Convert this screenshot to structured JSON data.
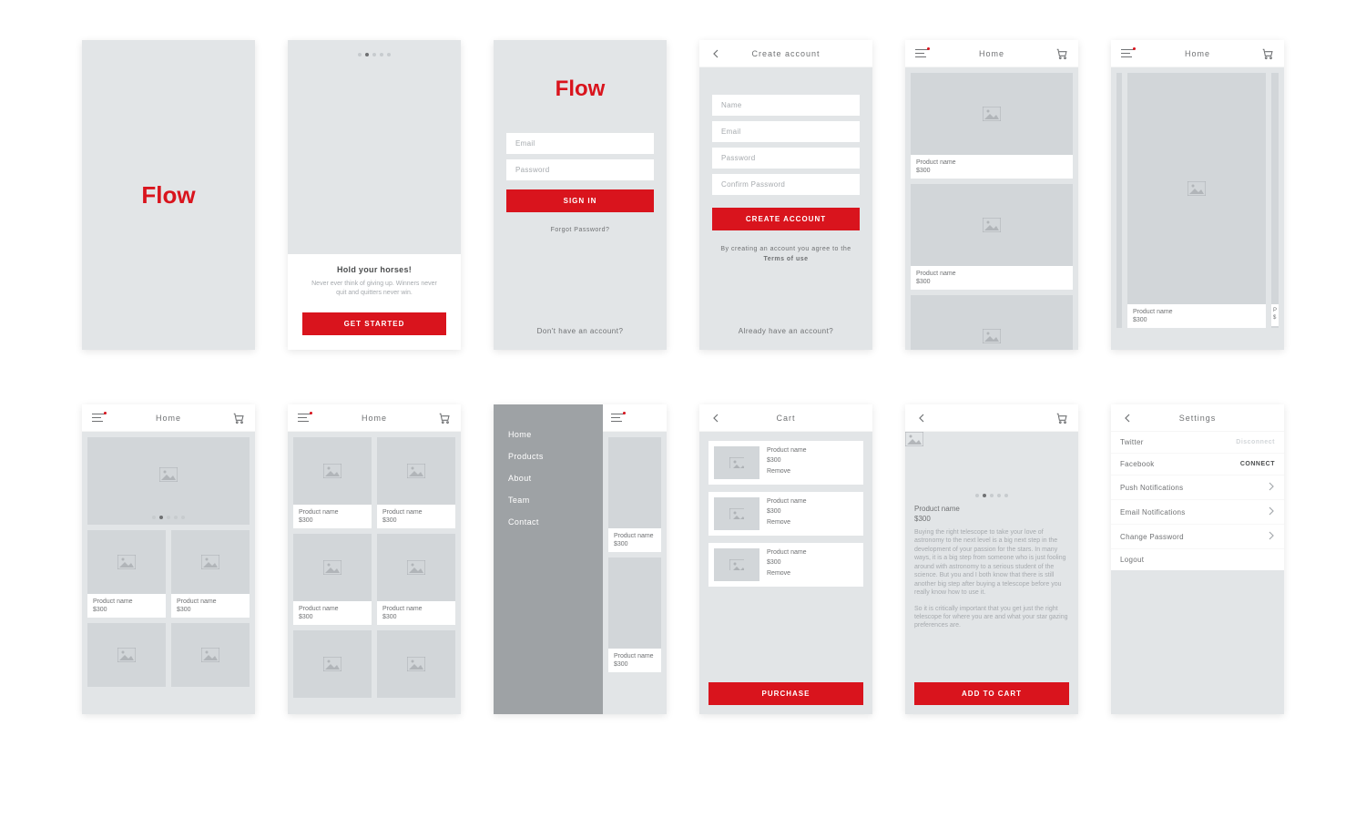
{
  "brand": "Flow",
  "colors": {
    "accent": "#D9141D"
  },
  "onboarding": {
    "title": "Hold your horses!",
    "body": "Never ever think of giving up. Winners never quit and quitters never win.",
    "cta": "GET STARTED"
  },
  "signin": {
    "email_ph": "Email",
    "password_ph": "Password",
    "cta": "SIGN IN",
    "forgot": "Forgot Password?",
    "no_account": "Don't have an account?"
  },
  "create": {
    "title": "Create account",
    "name_ph": "Name",
    "email_ph": "Email",
    "password_ph": "Password",
    "confirm_ph": "Confirm Password",
    "cta": "CREATE ACCOUNT",
    "terms_pre": "By creating an account you agree to the ",
    "terms_link": "Terms of use",
    "already": "Already have an account?"
  },
  "nav": {
    "home_title": "Home",
    "cart_title": "Cart",
    "settings_title": "Settings"
  },
  "product": {
    "name": "Product name",
    "price": "$300"
  },
  "drawer": {
    "items": [
      "Home",
      "Products",
      "About",
      "Team",
      "Contact"
    ]
  },
  "cart": {
    "remove": "Remove",
    "purchase": "PURCHASE"
  },
  "detail": {
    "body1": "Buying the right telescope to take your love of astronomy to the next level is a big next step in the development of your passion for the stars. In many ways, it is a big step from someone who is just fooling around with astronomy to a serious student of the science. But you and I both know that there is still another big step after buying a telescope before you really know how to use it.",
    "body2": "So it is critically important that you get just the right telescope for where you are and what your star gazing preferences are.",
    "cta": "ADD TO CART"
  },
  "settings": {
    "twitter": "Twitter",
    "disconnect": "Disconnect",
    "facebook": "Facebook",
    "connect": "CONNECT",
    "push": "Push Notifications",
    "email": "Email Notifications",
    "change_pw": "Change Password",
    "logout": "Logout"
  }
}
